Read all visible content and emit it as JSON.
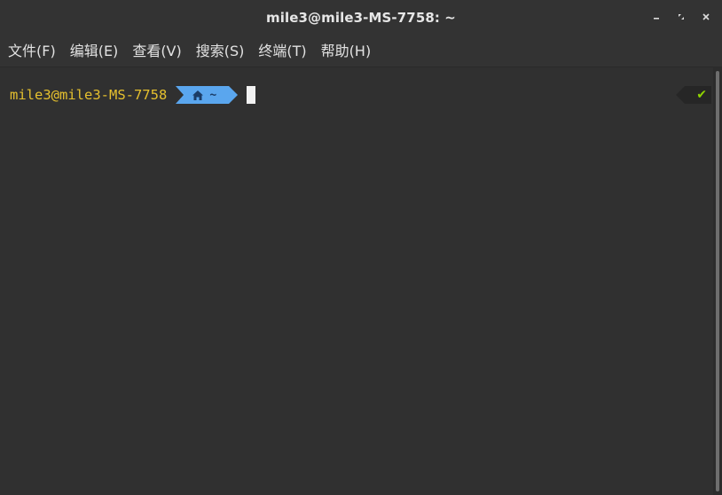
{
  "window": {
    "title": "mile3@mile3-MS-7758: ~",
    "controls": {
      "minimize": "–",
      "maximize": "▫",
      "close": "✕"
    }
  },
  "menu": {
    "items": [
      {
        "label": "文件(F)"
      },
      {
        "label": "编辑(E)"
      },
      {
        "label": "查看(V)"
      },
      {
        "label": "搜索(S)"
      },
      {
        "label": "终端(T)"
      },
      {
        "label": "帮助(H)"
      }
    ]
  },
  "terminal": {
    "user_host": "mile3@mile3-MS-7758",
    "cwd": "~",
    "status_symbol": "✔"
  },
  "icons": {
    "cwd_segment": "home-icon",
    "status": "checkmark-icon"
  },
  "colors": {
    "background": "#303030",
    "user_host": "#e5c02e",
    "cwd_segment": "#5aa6ee",
    "status_ok": "#8fd400"
  }
}
